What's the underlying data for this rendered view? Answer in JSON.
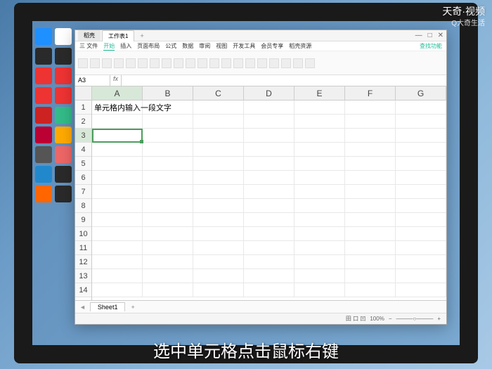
{
  "watermark": {
    "main": "天奇·视频",
    "sub": "Q大奇生活"
  },
  "subtitle": "选中单元格点击鼠标右键",
  "window": {
    "tabs": [
      "稻壳",
      "工作表1"
    ],
    "active_tab": 1,
    "win_min": "—",
    "win_max": "□",
    "win_close": "✕"
  },
  "menu": {
    "items": [
      "三 文件",
      "开始",
      "插入",
      "页面布局",
      "公式",
      "数据",
      "审阅",
      "视图",
      "开发工具",
      "会员专享",
      "稻壳资源"
    ],
    "search": "查找功能"
  },
  "formula": {
    "name_box": "A3",
    "fx": "fx",
    "value": ""
  },
  "columns": [
    "A",
    "B",
    "C",
    "D",
    "E",
    "F",
    "G"
  ],
  "selected_col": "A",
  "rows": [
    1,
    2,
    3,
    4,
    5,
    6,
    7,
    8,
    9,
    10,
    11,
    12,
    13,
    14
  ],
  "cell_a1": "单元格内输入一段文字",
  "selected_cell": "A3",
  "sheet_tab": "Sheet1",
  "status": {
    "zoom": "100%",
    "mode": "田 口 凹"
  },
  "chart_data": {
    "type": "table",
    "columns": [
      "A",
      "B",
      "C",
      "D",
      "E",
      "F",
      "G"
    ],
    "rows": [
      [
        "单元格内输入一段文字",
        "",
        "",
        "",
        "",
        "",
        ""
      ],
      [
        "",
        "",
        "",
        "",
        "",
        "",
        ""
      ],
      [
        "",
        "",
        "",
        "",
        "",
        "",
        ""
      ]
    ],
    "selected": "A3",
    "note": "Spreadsheet grid; only A1 has content"
  }
}
